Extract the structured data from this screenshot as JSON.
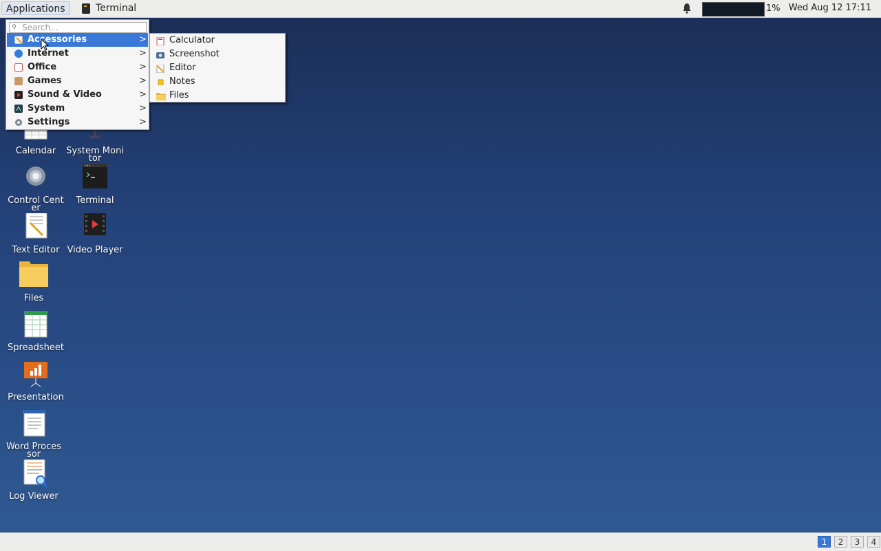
{
  "top_panel": {
    "applications_label": "Applications",
    "task_label": "Terminal",
    "cpu_percent": "1%",
    "clock": "Wed Aug 12  17:11"
  },
  "desktop_icons": [
    {
      "label": "Calendar",
      "icon": "calendar-icon"
    },
    {
      "label": "System Monitor",
      "icon": "system-monitor-icon"
    },
    {
      "label": "Control Center",
      "icon": "control-center-icon"
    },
    {
      "label": "Terminal",
      "icon": "terminal-icon"
    },
    {
      "label": "Text Editor",
      "icon": "text-editor-icon"
    },
    {
      "label": "Video Player",
      "icon": "video-player-icon"
    },
    {
      "label": "Files",
      "icon": "folder-icon"
    },
    {
      "label": "Spreadsheet",
      "icon": "spreadsheet-icon"
    },
    {
      "label": "Presentation",
      "icon": "presentation-icon"
    },
    {
      "label": "Word Processor",
      "icon": "word-processor-icon"
    },
    {
      "label": "Log Viewer",
      "icon": "log-viewer-icon"
    }
  ],
  "app_menu": {
    "search_placeholder": "Search...",
    "categories": [
      {
        "label": "Accessories",
        "arrow": ">",
        "selected": true
      },
      {
        "label": "Internet",
        "arrow": ">"
      },
      {
        "label": "Office",
        "arrow": ">"
      },
      {
        "label": "Games",
        "arrow": ">"
      },
      {
        "label": "Sound & Video",
        "arrow": ">"
      },
      {
        "label": "System",
        "arrow": ">"
      },
      {
        "label": "Settings",
        "arrow": ">"
      }
    ],
    "submenu": [
      {
        "label": "Calculator",
        "icon": "calculator-icon"
      },
      {
        "label": "Screenshot",
        "icon": "screenshot-icon"
      },
      {
        "label": "Editor",
        "icon": "editor-icon"
      },
      {
        "label": "Notes",
        "icon": "notes-icon"
      },
      {
        "label": "Files",
        "icon": "folder-icon"
      }
    ]
  },
  "workspaces": [
    "1",
    "2",
    "3",
    "4"
  ],
  "active_workspace": "1",
  "colors": {
    "accent": "#3a78d8",
    "panel": "#ededec",
    "desktop_top": "#1a2d55",
    "desktop_bottom": "#2f5a94"
  }
}
